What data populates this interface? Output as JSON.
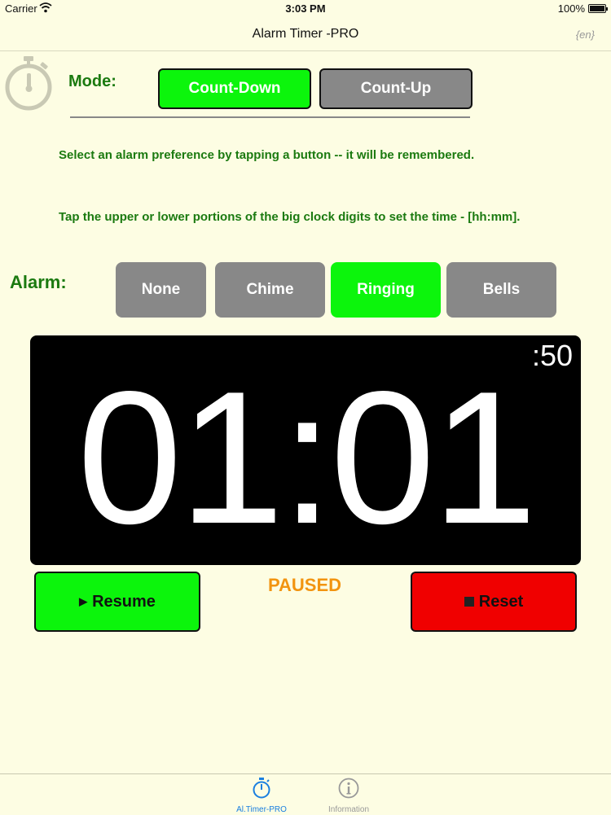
{
  "status_bar": {
    "carrier": "Carrier",
    "time": "3:03 PM",
    "battery": "100%"
  },
  "nav": {
    "title": "Alarm Timer -PRO",
    "language": "{en}"
  },
  "mode": {
    "label": "Mode:",
    "options": [
      "Count-Down",
      "Count-Up"
    ],
    "selected": "Count-Down"
  },
  "instructions": [
    "Select an alarm preference by tapping a button -- it will be remembered.",
    "Tap the upper or lower portions of the big clock digits to set the time - [hh:mm]."
  ],
  "alarm": {
    "label": "Alarm:",
    "options": [
      "None",
      "Chime",
      "Ringing",
      "Bells"
    ],
    "selected": "Ringing"
  },
  "clock": {
    "time": "01:01",
    "seconds": ":50"
  },
  "controls": {
    "resume": "Resume",
    "status": "PAUSED",
    "reset": "Reset"
  },
  "tabs": [
    {
      "label": "Al.Timer-PRO",
      "icon": "stopwatch-icon",
      "active": true
    },
    {
      "label": "Information",
      "icon": "info-icon",
      "active": false
    }
  ],
  "colors": {
    "background": "#fdfde3",
    "accent_green": "#0cf50c",
    "text_green": "#1b7a10",
    "inactive_gray": "#888888",
    "reset_red": "#f00000",
    "paused_orange": "#f29410",
    "tab_active": "#1a7fe0"
  }
}
